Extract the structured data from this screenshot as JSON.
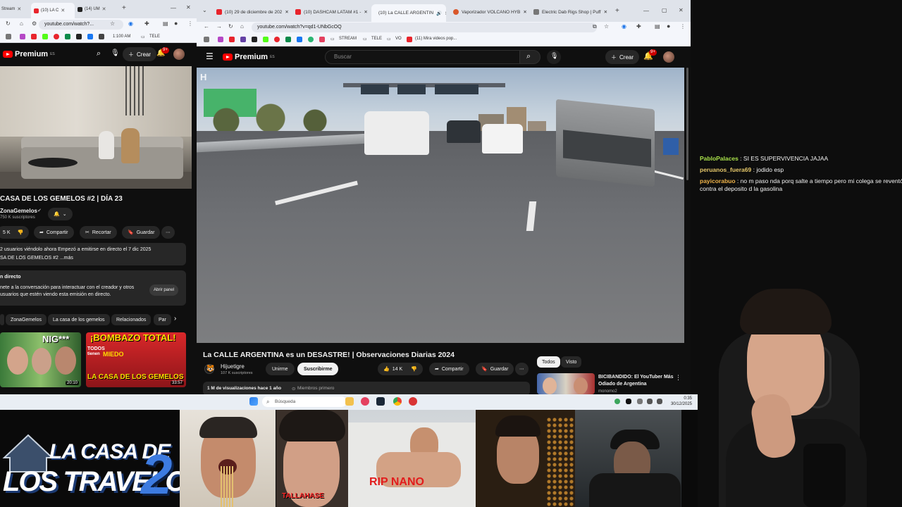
{
  "left_browser": {
    "tabs": [
      {
        "title": "Stream"
      },
      {
        "title": "(10) LA C"
      },
      {
        "title": "(14) UM"
      }
    ],
    "url": "youtube.com/watch?...",
    "bookmark_label": "1:100 AM",
    "bookmark_folder": "TELE",
    "yt_brand": "Premium",
    "yt_brand_sup": "ES",
    "create_label": "Crear",
    "notif_count": "9+",
    "video_title": "CASA DE LOS GEMELOS #2 | DÍA 23",
    "channel_name": "ZonaGemelos",
    "channel_subs": "750 K suscriptores",
    "like_count": "5 K",
    "share_label": "Compartir",
    "clip_label": "Recortar",
    "save_label": "Guardar",
    "desc_line1": "2 usuarios viéndolo ahora  Empezó a emitirse en directo el 7 dic 2025",
    "desc_line2": "SA DE LOS GEMELOS #2 ...más",
    "live_heading": "n directo",
    "live_text1": "nete a la conversación para interactuar con el creador y otros",
    "live_text2": "usuarios que estén viendo esta emisión en directo.",
    "open_panel": "Abrir panel",
    "chips": [
      "ZonaGemelos",
      "La casa de los gemelos",
      "Relacionados",
      "Par"
    ],
    "thumb1_duration": "20:10",
    "thumb1_text": "NIG***",
    "thumb2_duration": "33:57",
    "thumb2_text": "¡BOMBAZO TOTAL!",
    "thumb2_sub": "LA CASA DE LOS GEMELOS",
    "thumb2_tag1": "TODOS",
    "thumb2_tag2": "tienen",
    "thumb2_tag3": "MIEDO"
  },
  "main_browser": {
    "tabs": [
      {
        "title": "(10) 29 de diciembre de 202",
        "color": "#e8242c"
      },
      {
        "title": "(10) DASHCAM LATAM #1 -",
        "color": "#e8242c"
      },
      {
        "title": "(10) La CALLE ARGENTIN",
        "color": "#e8242c"
      },
      {
        "title": "Vaporizador VOLCANO HYB",
        "color": "#d9572a"
      },
      {
        "title": "Electric Dab Rigs Shop | Puff",
        "color": "#777777"
      }
    ],
    "url": "youtube.com/watch?v=qd1-UNbGcOQ",
    "bookmarks": [
      "STREAM",
      "TELE",
      "VO",
      "(11) Mira videos pop..."
    ],
    "yt_brand": "Premium",
    "yt_brand_sup": "ES",
    "search_placeholder": "Buscar",
    "create_label": "Crear",
    "notif_count": "9+",
    "video_watermark": "H",
    "video_title": "La CALLE ARGENTINA es un DESASTRE! | Observaciones Diarias 2024",
    "channel_name": "Hijuetigre",
    "channel_subs": "107 K suscriptores",
    "join_label": "Unirme",
    "subscribe_label": "Suscribirme",
    "like_count": "14 K",
    "share_label": "Compartir",
    "save_label": "Guardar",
    "views_line": "1 M de visualizaciones  hace 1 año",
    "members_label": "Miembros primero",
    "filter_chips": [
      "Todos",
      "Visto"
    ],
    "rec_title_line1": "BICIBANDIDO: El YouTuber Más",
    "rec_title_line2": "Odiado de Argentina",
    "rec_channel": "monomo2"
  },
  "taskbar": {
    "search_placeholder": "Búsqueda",
    "time": "0:35",
    "date": "30/12/2025"
  },
  "chat": [
    {
      "user": "PabloPalaces",
      "color": "#a8e04a",
      "message": "SI ES SUPERVIVENCIA JAJAA"
    },
    {
      "user": "peruanos_fuera69",
      "color": "#e6c86a",
      "message": "jodido esp"
    },
    {
      "user": "payicorabuo",
      "color": "#f0b44a",
      "message": "no m paso nda porq salte a tiempo pero mi colega se reventó contra el deposito d la gasolina"
    }
  ],
  "bottom_strip": {
    "logo_line1": "LA CASA DE",
    "logo_line2": "LOS TRAVELOS",
    "logo_number": "2",
    "cam2_caption": "TALLAHASE",
    "cam3_caption": "RIP NANO"
  },
  "colors": {
    "yt_red": "#ff0000",
    "dark_bg": "#0f0f0f",
    "chip_bg": "#272727",
    "notif_red": "#cc0000"
  }
}
